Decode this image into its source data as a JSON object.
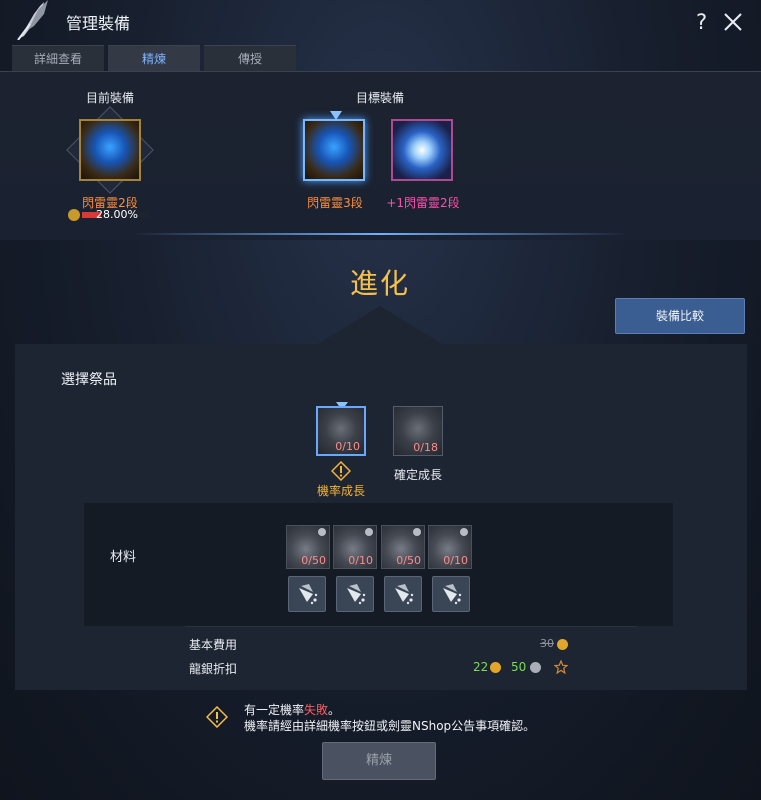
{
  "window": {
    "title": "管理裝備"
  },
  "tabs": [
    {
      "label": "詳細查看"
    },
    {
      "label": "精煉"
    },
    {
      "label": "傳授"
    }
  ],
  "current_equipment": {
    "heading": "目前裝備",
    "name": "閃雷靈2段",
    "exp_text": "28.00%",
    "exp_fraction": 0.28
  },
  "target_equipment": {
    "heading": "目標裝備",
    "option_a": "閃雷靈3段",
    "option_b": "+1閃雷靈2段"
  },
  "stage_title": "進化",
  "compare_button": "裝備比較",
  "offering": {
    "title": "選擇祭品",
    "options": [
      {
        "label": "機率成長",
        "count": "0/10",
        "selected": true
      },
      {
        "label": "確定成長",
        "count": "0/18",
        "selected": false
      }
    ]
  },
  "materials": {
    "title": "材料",
    "items": [
      {
        "count": "0/50"
      },
      {
        "count": "0/10"
      },
      {
        "count": "0/50"
      },
      {
        "count": "0/10"
      }
    ]
  },
  "costs": {
    "base_label": "基本費用",
    "base_value": "30",
    "discount_label": "龍銀折扣",
    "discount_value_1": "22",
    "discount_value_2": "50"
  },
  "notice": {
    "line1_prefix": "有一定機率",
    "line1_highlight": "失敗",
    "line1_suffix": "。",
    "line2": "機率請經由詳細機率按鈕或劍靈NShop公告事項確認。"
  },
  "refine_button": "精煉",
  "colors": {
    "accent_blue": "#3a5d92",
    "gold": "#f3c04d",
    "fail_red": "#ff5a5a",
    "exp_red": "#d83a3a"
  },
  "icons": [
    "blade-icon",
    "help-icon",
    "close-icon",
    "warning-icon",
    "shop-icon",
    "gold-coin-icon",
    "silver-coin-icon",
    "star-icon"
  ]
}
